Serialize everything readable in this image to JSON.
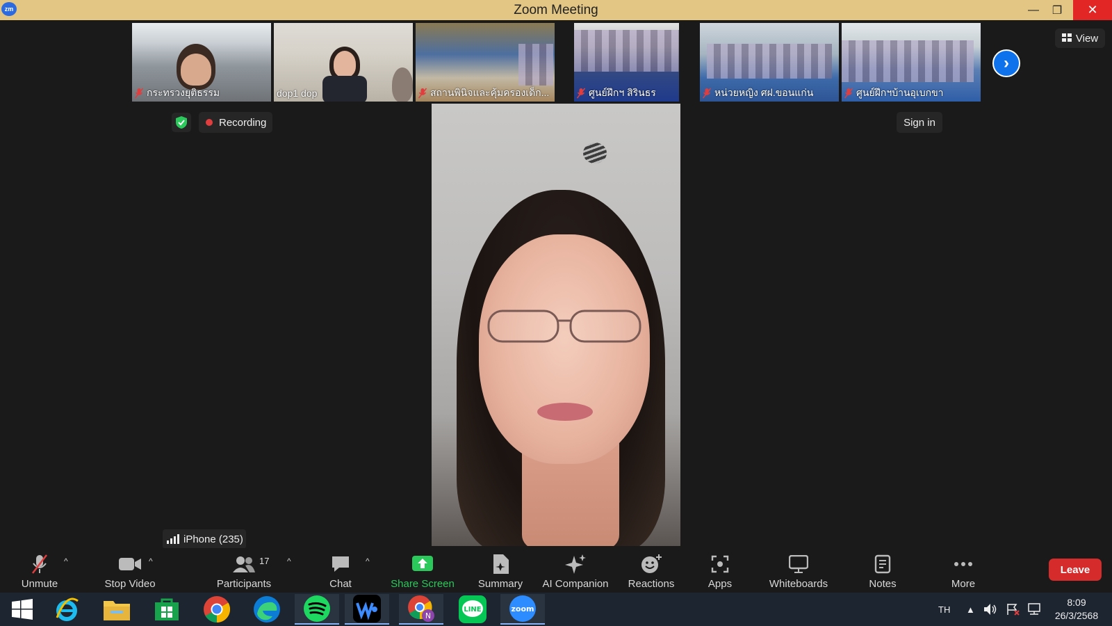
{
  "window": {
    "title": "Zoom Meeting",
    "app_icon": "zm"
  },
  "thumbnails": [
    {
      "name": "กระทรวงยุติธรรม",
      "muted": true
    },
    {
      "name": "dop1 dop",
      "muted": false
    },
    {
      "name": "สถานพินิจและคุ้มครองเด็ก...",
      "muted": true
    },
    {
      "name": "ศูนย์ฝึกฯ สิรินธร",
      "muted": true
    },
    {
      "name": "หน่วยหญิง ศฝ.ขอนแก่น",
      "muted": true
    },
    {
      "name": "ศูนย์ฝึกฯบ้านอุเบกขา",
      "muted": true
    }
  ],
  "top_controls": {
    "view_label": "View",
    "recording_label": "Recording",
    "signin_label": "Sign in"
  },
  "active_speaker": {
    "device_label": "iPhone (235)"
  },
  "toolbar": {
    "unmute": "Unmute",
    "stop_video": "Stop Video",
    "participants": "Participants",
    "participants_count": "17",
    "chat": "Chat",
    "share_screen": "Share Screen",
    "summary": "Summary",
    "ai_companion": "AI Companion",
    "reactions": "Reactions",
    "apps": "Apps",
    "whiteboards": "Whiteboards",
    "notes": "Notes",
    "more": "More",
    "leave": "Leave"
  },
  "taskbar": {
    "apps": [
      "windows-start-icon",
      "internet-explorer-icon",
      "file-explorer-icon",
      "store-icon",
      "chrome-icon",
      "edge-icon",
      "spotify-icon",
      "webtoon-icon",
      "chrome-profile-icon",
      "line-icon",
      "zoom-icon"
    ],
    "language": "TH",
    "time": "8:09",
    "date": "26/3/2568"
  },
  "colors": {
    "accent": "#0e72ed",
    "share": "#2bc85b",
    "leave": "#d62b2b",
    "titlebar": "#e3c684"
  }
}
